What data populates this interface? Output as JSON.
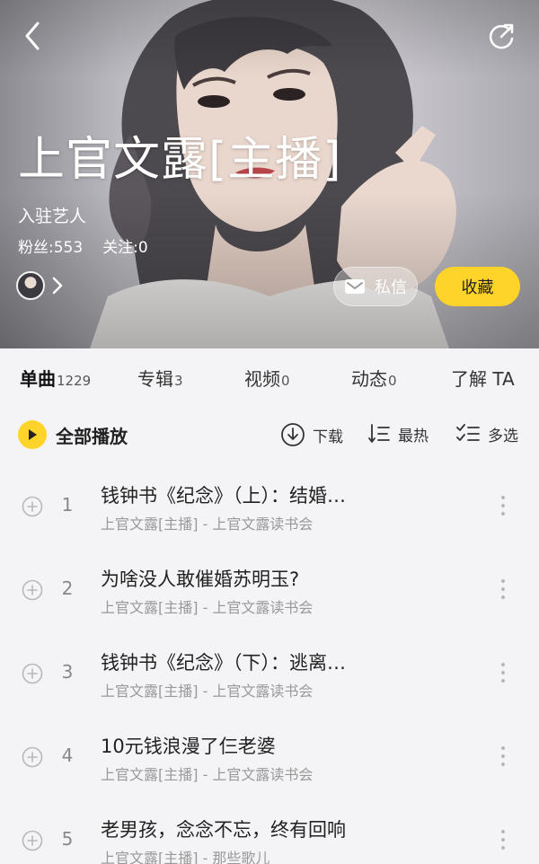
{
  "header": {
    "artist_name": "上官文露[主播]",
    "artist_tag": "入驻艺人",
    "fans_label": "粉丝:553",
    "following_label": "关注:0",
    "message_label": "私信",
    "favorite_label": "收藏"
  },
  "tabs": [
    {
      "label": "单曲",
      "count": "1229",
      "active": true
    },
    {
      "label": "专辑",
      "count": "3"
    },
    {
      "label": "视频",
      "count": "0"
    },
    {
      "label": "动态",
      "count": "0"
    },
    {
      "label": "了解 TA",
      "count": ""
    }
  ],
  "toolbar": {
    "play_all_label": "全部播放",
    "download_label": "下载",
    "sort_label": "最热",
    "multiselect_label": "多选"
  },
  "tracks": [
    {
      "index": "1",
      "title": "钱钟书《纪念》（上）：结婚…",
      "subtitle": "上官文露[主播] - 上官文露读书会"
    },
    {
      "index": "2",
      "title": "为啥没人敢催婚苏明玉?",
      "subtitle": "上官文露[主播] - 上官文露读书会"
    },
    {
      "index": "3",
      "title": "钱钟书《纪念》（下）：逃离…",
      "subtitle": "上官文露[主播] - 上官文露读书会"
    },
    {
      "index": "4",
      "title": "10元钱浪漫了仨老婆",
      "subtitle": "上官文露[主播] - 上官文露读书会"
    },
    {
      "index": "5",
      "title": "老男孩，念念不忘，终有回响",
      "subtitle": "上官文露[主播] - 那些歌儿"
    }
  ],
  "colors": {
    "accent": "#ffd42a",
    "background": "#f4f4f6",
    "secondary_text": "#999999"
  },
  "icons": [
    "back-icon",
    "share-icon",
    "mail-icon",
    "chevron-right-icon",
    "play-icon",
    "download-icon",
    "sort-icon",
    "multiselect-icon",
    "add-icon",
    "more-icon"
  ]
}
